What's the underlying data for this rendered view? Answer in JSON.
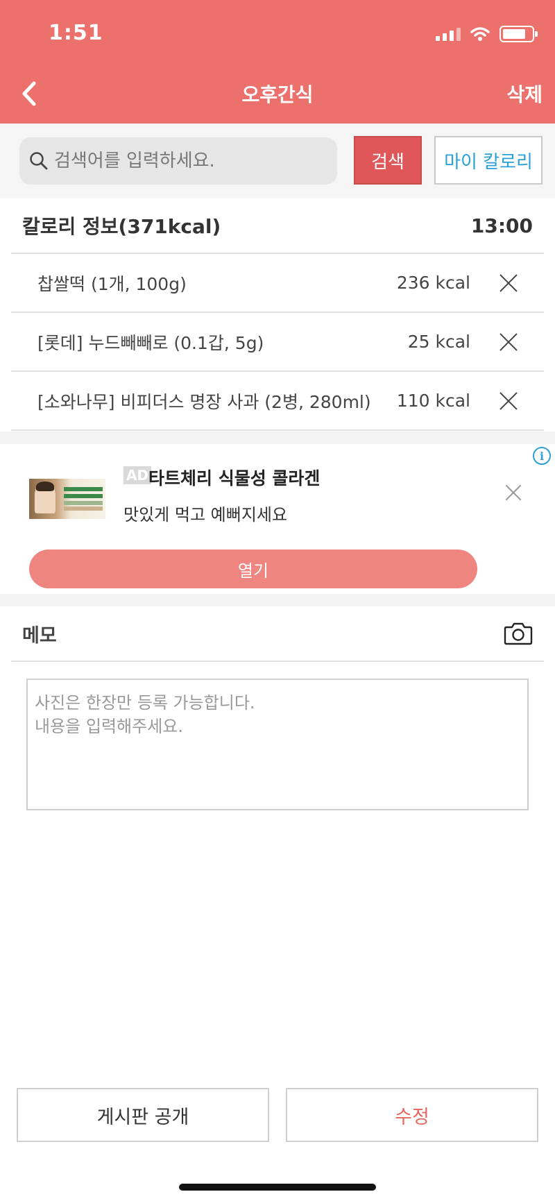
{
  "status_bar": {
    "time": "1:51"
  },
  "nav": {
    "title": "오후간식",
    "delete_label": "삭제"
  },
  "search": {
    "placeholder": "검색어를 입력하세요.",
    "search_label": "검색",
    "my_calorie_label": "마이 칼로리"
  },
  "calorie_info": {
    "title": "칼로리 정보(371kcal)",
    "time": "13:00",
    "items": [
      {
        "name": "찹쌀떡 (1개, 100g)",
        "kcal": "236 kcal"
      },
      {
        "name": "[롯데] 누드빼빼로 (0.1갑, 5g)",
        "kcal": "25 kcal"
      },
      {
        "name": "[소와나무] 비피더스 명장 사과 (2병, 280ml)",
        "kcal": "110 kcal"
      }
    ]
  },
  "ad": {
    "badge": "AD",
    "title": "타트체리 식물성 콜라겐",
    "description": "맛있게 먹고 예뻐지세요",
    "open_label": "열기",
    "info_icon": "i"
  },
  "memo": {
    "title": "메모",
    "placeholder": "사진은 한장만 등록 가능합니다.\n내용을 입력해주세요."
  },
  "actions": {
    "public_label": "게시판 공개",
    "edit_label": "수정"
  },
  "colors": {
    "header": "#ec706b",
    "search_button": "#e0575a",
    "ad_button": "#ee8580",
    "edit_text": "#e8645f",
    "link_blue": "#2a9fd8"
  }
}
